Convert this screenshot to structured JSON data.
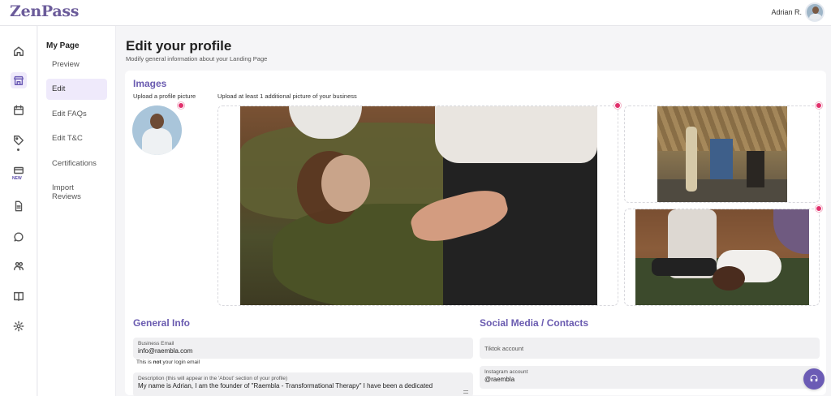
{
  "app": {
    "logo": "ZenPass"
  },
  "user": {
    "name": "Adrian R."
  },
  "rail": {
    "items": [
      {
        "name": "home-icon"
      },
      {
        "name": "store-icon",
        "active": true
      },
      {
        "name": "calendar-icon"
      },
      {
        "name": "tag-icon"
      },
      {
        "name": "ticket-icon",
        "badge": "NEW"
      },
      {
        "name": "document-icon"
      },
      {
        "name": "chat-bubble-icon"
      },
      {
        "name": "people-icon"
      },
      {
        "name": "book-icon"
      },
      {
        "name": "settings-icon"
      }
    ]
  },
  "submenu": {
    "title": "My Page",
    "items": [
      {
        "label": "Preview"
      },
      {
        "label": "Edit",
        "active": true
      },
      {
        "label": "Edit FAQs"
      },
      {
        "label": "Edit T&C"
      },
      {
        "label": "Certifications"
      },
      {
        "label": "Import Reviews"
      }
    ]
  },
  "page": {
    "title": "Edit your profile",
    "subtitle": "Modify general information about your Landing Page"
  },
  "images": {
    "title": "Images",
    "profile_hint": "Upload a profile picture",
    "additional_hint": "Upload at least 1 additional picture of your business"
  },
  "general": {
    "title": "General Info",
    "email_label": "Business Email",
    "email_value": "info@raembla.com",
    "email_help_prefix": "This is ",
    "email_help_bold": "not",
    "email_help_suffix": " your login email",
    "description_label": "Description (this will appear in the 'About' section of your profile)",
    "description_value": "My name is Adrian, I am the founder of \"Raembla - Transformational Therapy\" I have been a dedicated"
  },
  "social": {
    "title": "Social Media / Contacts",
    "tiktok_placeholder": "Tiktok account",
    "instagram_label": "Instagram account",
    "instagram_value": "@raembla"
  },
  "colors": {
    "accent": "#6b5bb5",
    "remove": "#e1306c",
    "logo": "#6b5b9a"
  }
}
